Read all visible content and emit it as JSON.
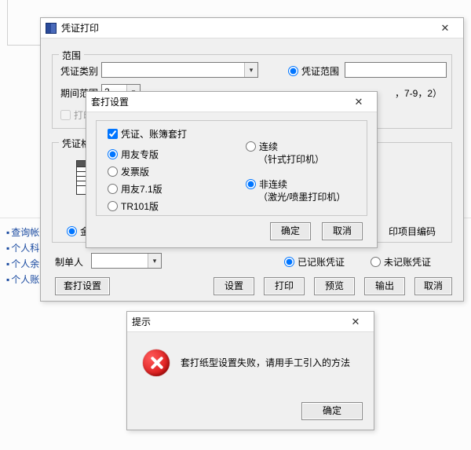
{
  "tree": {
    "links": [
      "查询帐",
      "个人科",
      "个人余",
      "个人账"
    ]
  },
  "mainWin": {
    "title": "凭证打印",
    "groupScope": "范围",
    "voucherType": "凭证类别",
    "voucherTypeValue": "",
    "periodRange": "期间范围",
    "periodValue": "2",
    "voucherRangeRadio": "凭证范围",
    "voucherRangeValue": "",
    "hintText": "，7-9，2）",
    "printQuery": "打印查询",
    "formatGroup": "凭证格式",
    "amountStyle": "金额式",
    "printProjCode": "印项目编码",
    "maker": "制单人",
    "makerValue": "",
    "postedRadio": "已记账凭证",
    "unpostedRadio": "未记账凭证",
    "btnOverlay": "套打设置",
    "btnSetting": "设置",
    "btnPrint": "打印",
    "btnPreview": "预览",
    "btnOutput": "输出",
    "btnCancel": "取消"
  },
  "overlayWin": {
    "title": "套打设置",
    "chkOverlay": "凭证、账簿套打",
    "optYY": "用友专版",
    "optInvoice": "发票版",
    "optYY71": "用友7.1版",
    "optTR101": "TR101版",
    "optCont": "连续",
    "optContHint": "（针式打印机）",
    "optNonCont": "非连续",
    "optNonContHint": "（激光/喷墨打印机）",
    "btnOK": "确定",
    "btnCancel": "取消"
  },
  "msgWin": {
    "title": "提示",
    "text": "套打纸型设置失败，请用手工引入的方法",
    "btnOK": "确定"
  }
}
